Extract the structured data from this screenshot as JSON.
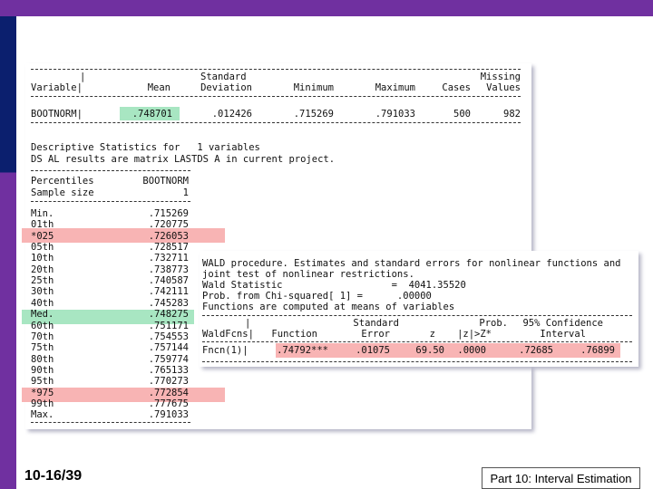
{
  "panel1": {
    "header_row1": [
      "|",
      "Standard",
      "Missing"
    ],
    "header_row2": [
      "Variable|",
      "Mean",
      "Deviation",
      "Minimum",
      "Maximum",
      "Cases",
      "Values"
    ],
    "data_row": [
      "BOOTNORM|",
      ".748701",
      ".012426",
      ".715269",
      ".791033",
      "500",
      "982"
    ],
    "desc_line1": "Descriptive Statistics for   1 variables",
    "desc_line2": "DS AL results are matrix LASTDS A in current project.",
    "pct_header1": [
      "Percentiles",
      "BOOTNORM"
    ],
    "pct_header2": [
      "Sample size",
      "1"
    ],
    "percentiles": [
      {
        "label": "Min.",
        "value": ".715269"
      },
      {
        "label": "01th",
        "value": ".720775"
      },
      {
        "label": "*025",
        "value": ".726053"
      },
      {
        "label": "05th",
        "value": ".728517"
      },
      {
        "label": "10th",
        "value": ".732711"
      },
      {
        "label": "20th",
        "value": ".738773"
      },
      {
        "label": "25th",
        "value": ".740587"
      },
      {
        "label": "30th",
        "value": ".742111"
      },
      {
        "label": "40th",
        "value": ".745283"
      },
      {
        "label": "Med.",
        "value": ".748275"
      },
      {
        "label": "60th",
        "value": ".751171"
      },
      {
        "label": "70th",
        "value": ".754553"
      },
      {
        "label": "75th",
        "value": ".757144"
      },
      {
        "label": "80th",
        "value": ".759774"
      },
      {
        "label": "90th",
        "value": ".765133"
      },
      {
        "label": "95th",
        "value": ".770273"
      },
      {
        "label": "*975",
        "value": ".772854"
      },
      {
        "label": "99th",
        "value": ".777675"
      },
      {
        "label": "Max.",
        "value": ".791033"
      }
    ]
  },
  "panel2": {
    "lines": [
      "WALD procedure. Estimates and standard errors for nonlinear functions and",
      "joint test of nonlinear restrictions.",
      "Wald Statistic                   =  4041.35520",
      "Prob. from Chi-squared[ 1] =      .00000",
      "Functions are computed at means of variables"
    ],
    "header_row1": [
      "|",
      "Standard",
      "Prob.",
      "95% Confidence"
    ],
    "header_row2": [
      "WaldFcns|",
      "Function",
      "Error",
      "z",
      "|z|>Z*",
      "Interval"
    ],
    "data_row": [
      "Fncn(1)|",
      ".74792***",
      ".01075",
      "69.50",
      ".0000",
      ".72685",
      ".76899"
    ]
  },
  "footer": {
    "slide_number": "10-16/39",
    "title": "Part 10: Interval Estimation"
  },
  "colors": {
    "top_bar": "#7030a0",
    "left_bar_top": "#0b1f6e",
    "left_bar_bottom": "#7030a0",
    "highlight_green": "#a8e6c2",
    "highlight_red": "#f8b4b4"
  }
}
